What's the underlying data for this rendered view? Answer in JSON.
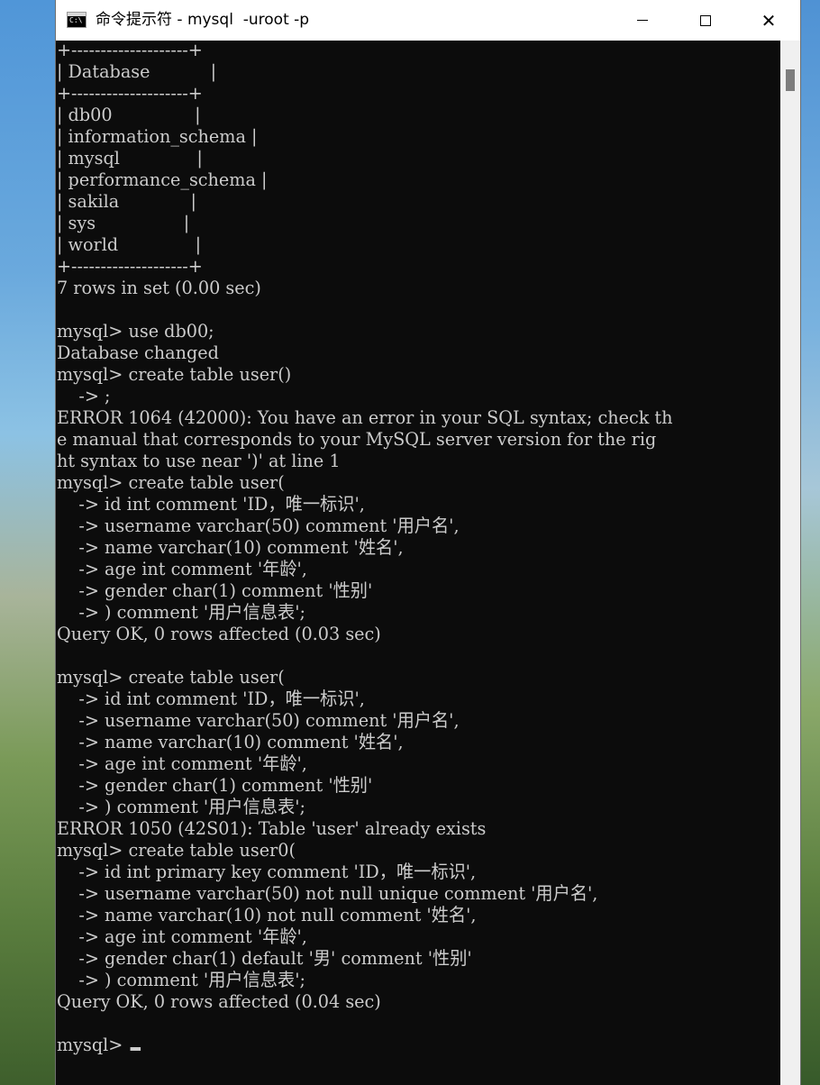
{
  "window": {
    "title": "命令提示符 - mysql  -uroot -p",
    "minimize_label": "—",
    "maximize_label": "☐",
    "close_label": "✕"
  },
  "console": {
    "lines": [
      "+--------------------+",
      "| Database           |",
      "+--------------------+",
      "| db00               |",
      "| information_schema |",
      "| mysql              |",
      "| performance_schema |",
      "| sakila             |",
      "| sys                |",
      "| world              |",
      "+--------------------+",
      "7 rows in set (0.00 sec)",
      "",
      "mysql> use db00;",
      "Database changed",
      "mysql> create table user()",
      "    -> ;",
      "ERROR 1064 (42000): You have an error in your SQL syntax; check th",
      "e manual that corresponds to your MySQL server version for the rig",
      "ht syntax to use near ')' at line 1",
      "mysql> create table user(",
      "    -> id int comment 'ID，唯一标识',",
      "    -> username varchar(50) comment '用户名',",
      "    -> name varchar(10) comment '姓名',",
      "    -> age int comment '年龄',",
      "    -> gender char(1) comment '性别'",
      "    -> ) comment '用户信息表';",
      "Query OK, 0 rows affected (0.03 sec)",
      "",
      "mysql> create table user(",
      "    -> id int comment 'ID，唯一标识',",
      "    -> username varchar(50) comment '用户名',",
      "    -> name varchar(10) comment '姓名',",
      "    -> age int comment '年龄',",
      "    -> gender char(1) comment '性别'",
      "    -> ) comment '用户信息表';",
      "ERROR 1050 (42S01): Table 'user' already exists",
      "mysql> create table user0(",
      "    -> id int primary key comment 'ID，唯一标识',",
      "    -> username varchar(50) not null unique comment '用户名',",
      "    -> name varchar(10) not null comment '姓名',",
      "    -> age int comment '年龄',",
      "    -> gender char(1) default '男' comment '性别'",
      "    -> ) comment '用户信息表';",
      "Query OK, 0 rows affected (0.04 sec)",
      "",
      "mysql> "
    ]
  },
  "colors": {
    "console_bg": "#0c0c0c",
    "console_fg": "#cccccc",
    "titlebar_bg": "#ffffff"
  },
  "icons": {
    "app": "cmd-icon",
    "minimize": "minimize-icon",
    "maximize": "maximize-icon",
    "close": "close-icon"
  }
}
